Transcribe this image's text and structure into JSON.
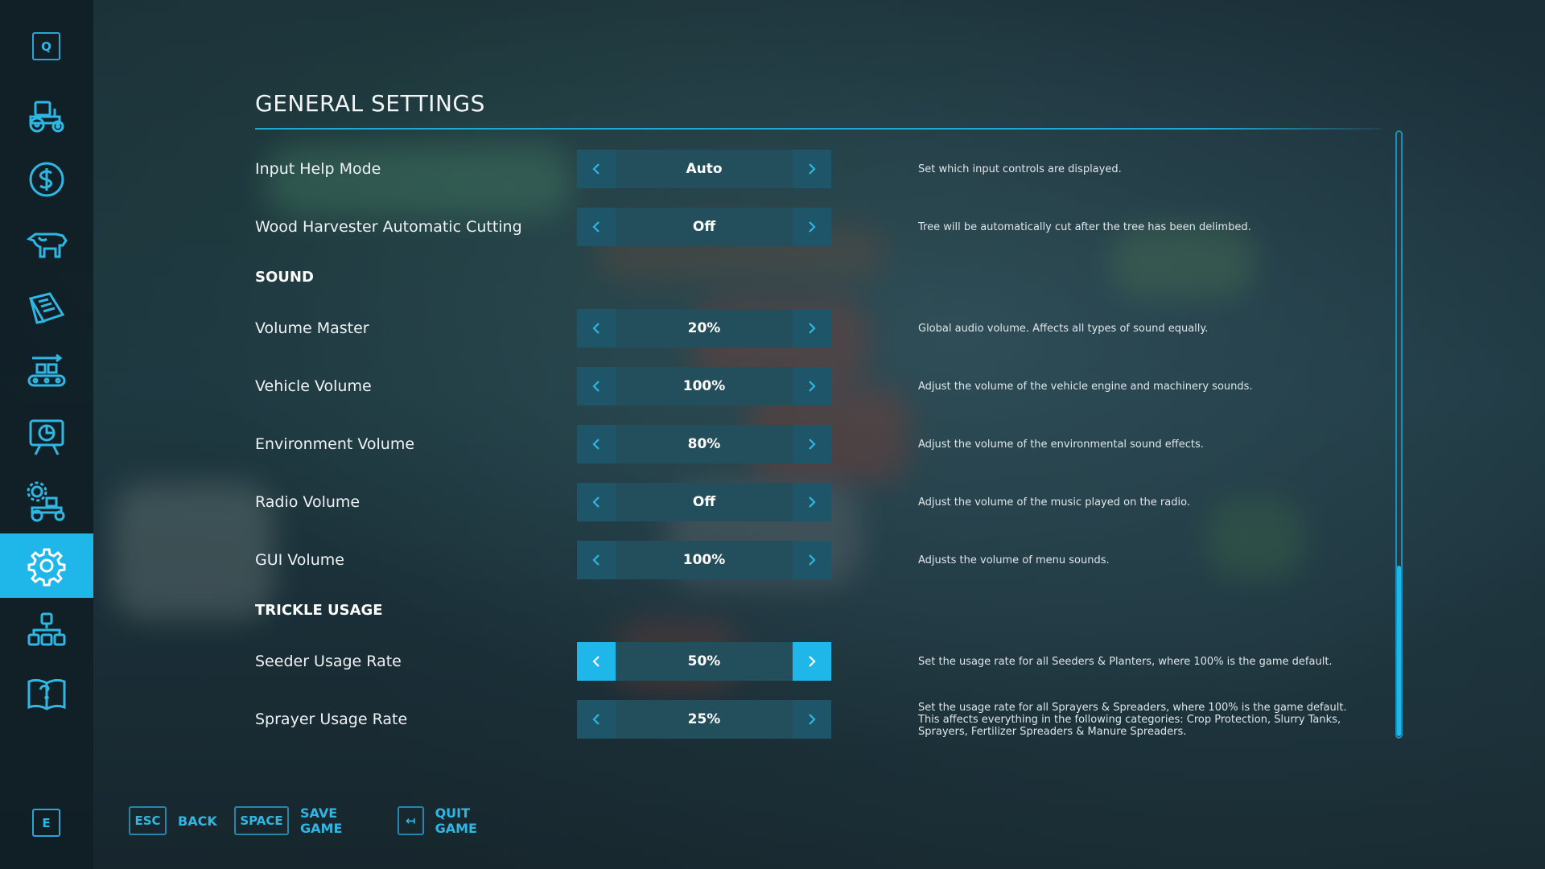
{
  "sidebar": {
    "top_key": "Q",
    "bottom_key": "E",
    "items": [
      {
        "icon": "tractor-icon"
      },
      {
        "icon": "dollar-icon"
      },
      {
        "icon": "cow-icon"
      },
      {
        "icon": "contracts-icon"
      },
      {
        "icon": "production-chain-icon"
      },
      {
        "icon": "statistics-board-icon"
      },
      {
        "icon": "vehicle-settings-icon"
      },
      {
        "icon": "settings-gear-icon",
        "active": true
      },
      {
        "icon": "boxes-icon"
      },
      {
        "icon": "help-book-icon"
      }
    ]
  },
  "page": {
    "title": "GENERAL SETTINGS"
  },
  "sections": {
    "sound": "SOUND",
    "trickle": "TRICKLE USAGE"
  },
  "settings": [
    {
      "label": "Input Help Mode",
      "value": "Auto",
      "desc": "Set which input controls are displayed."
    },
    {
      "label": "Wood Harvester Automatic Cutting",
      "value": "Off",
      "desc": "Tree will be automatically cut after the tree has been delimbed."
    },
    {
      "label": "Volume Master",
      "value": "20%",
      "desc": "Global audio volume. Affects all types of sound equally."
    },
    {
      "label": "Vehicle Volume",
      "value": "100%",
      "desc": "Adjust the volume of the vehicle engine and machinery sounds."
    },
    {
      "label": "Environment Volume",
      "value": "80%",
      "desc": "Adjust the volume of the environmental sound effects."
    },
    {
      "label": "Radio Volume",
      "value": "Off",
      "desc": "Adjust the volume of the music played on the radio."
    },
    {
      "label": "GUI Volume",
      "value": "100%",
      "desc": "Adjusts the volume of menu sounds."
    },
    {
      "label": "Seeder Usage Rate",
      "value": "50%",
      "desc": "Set the usage rate for all Seeders & Planters, where 100% is the game default."
    },
    {
      "label": "Sprayer Usage Rate",
      "value": "25%",
      "desc": "Set the usage rate for all Sprayers & Spreaders, where 100% is the game default. This affects everything in the following categories: Crop Protection, Slurry Tanks, Sprayers, Fertilizer Spreaders & Manure Spreaders."
    }
  ],
  "footer": {
    "back_key": "ESC",
    "back_label": "BACK",
    "save_key": "SPACE",
    "save_label": "SAVE GAME",
    "quit_key": "↤",
    "quit_label": "QUIT GAME"
  },
  "colors": {
    "accent": "#1fb6ea",
    "stepper_value_bg": "#234f5d",
    "arrow_bg": "#1e5568"
  }
}
